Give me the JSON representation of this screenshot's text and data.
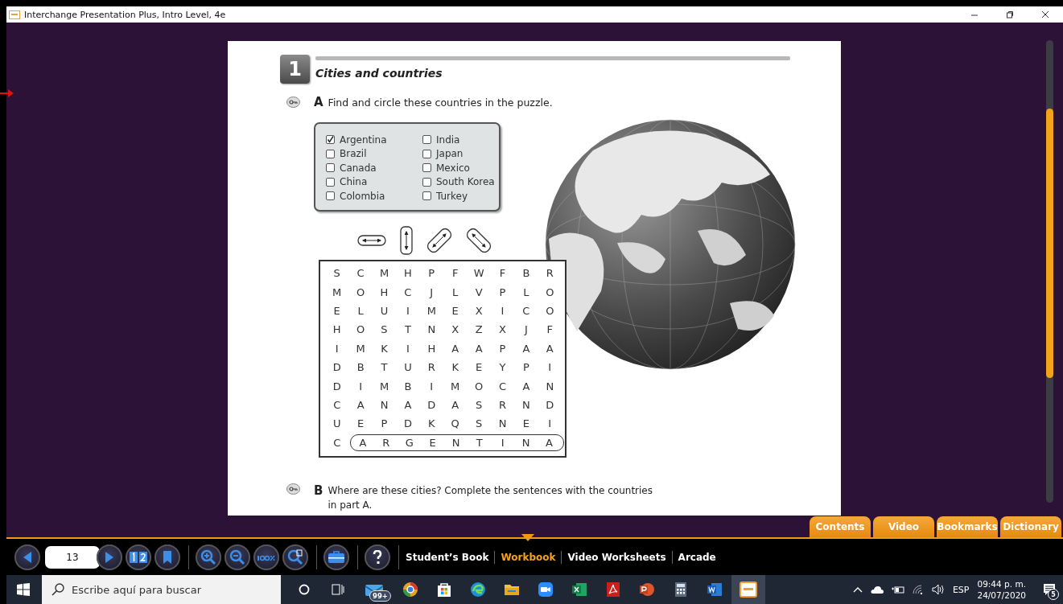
{
  "window": {
    "title": "Interchange Presentation Plus, Intro Level, 4e"
  },
  "page": {
    "exercise_number": "1",
    "section_title": "Cities and countries",
    "part_a": {
      "letter": "A",
      "instruction": "Find and circle these countries in the puzzle."
    },
    "checklist": [
      {
        "label": "Argentina",
        "checked": true
      },
      {
        "label": "Brazil",
        "checked": false
      },
      {
        "label": "Canada",
        "checked": false
      },
      {
        "label": "China",
        "checked": false
      },
      {
        "label": "Colombia",
        "checked": false
      },
      {
        "label": "India",
        "checked": false
      },
      {
        "label": "Japan",
        "checked": false
      },
      {
        "label": "Mexico",
        "checked": false
      },
      {
        "label": "South Korea",
        "checked": false
      },
      {
        "label": "Turkey",
        "checked": false
      }
    ],
    "word_search": {
      "rows": [
        {
          "segments": [
            {
              "letters": [
                "S",
                "C",
                "M",
                "H",
                "P",
                "F",
                "W",
                "F",
                "B",
                "R"
              ],
              "circled": false
            }
          ]
        },
        {
          "segments": [
            {
              "letters": [
                "M",
                "O",
                "H",
                "C",
                "J",
                "L",
                "V",
                "P",
                "L",
                "O"
              ],
              "circled": false
            }
          ]
        },
        {
          "segments": [
            {
              "letters": [
                "E",
                "L",
                "U",
                "I",
                "M",
                "E",
                "X",
                "I",
                "C",
                "O"
              ],
              "circled": false
            }
          ]
        },
        {
          "segments": [
            {
              "letters": [
                "H",
                "O",
                "S",
                "T",
                "N",
                "X",
                "Z",
                "X",
                "J",
                "F"
              ],
              "circled": false
            }
          ]
        },
        {
          "segments": [
            {
              "letters": [
                "I",
                "M",
                "K",
                "I",
                "H",
                "A",
                "A",
                "P",
                "A",
                "A"
              ],
              "circled": false
            }
          ]
        },
        {
          "segments": [
            {
              "letters": [
                "D",
                "B",
                "T",
                "U",
                "R",
                "K",
                "E",
                "Y",
                "P",
                "I"
              ],
              "circled": false
            }
          ]
        },
        {
          "segments": [
            {
              "letters": [
                "D",
                "I",
                "M",
                "B",
                "I",
                "M",
                "O",
                "C",
                "A",
                "N"
              ],
              "circled": false
            }
          ]
        },
        {
          "segments": [
            {
              "letters": [
                "C",
                "A",
                "N",
                "A",
                "D",
                "A",
                "S",
                "R",
                "N",
                "D"
              ],
              "circled": false
            }
          ]
        },
        {
          "segments": [
            {
              "letters": [
                "U",
                "E",
                "P",
                "D",
                "K",
                "Q",
                "S",
                "N",
                "E",
                "I"
              ],
              "circled": false
            }
          ]
        },
        {
          "segments": [
            {
              "letters": [
                "C"
              ],
              "circled": false
            },
            {
              "letters": [
                "A",
                "R",
                "G",
                "E",
                "N",
                "T",
                "I",
                "N",
                "A"
              ],
              "circled": true
            }
          ]
        }
      ]
    },
    "part_b": {
      "letter": "B",
      "instruction": "Where are these cities? Complete the sentences with the countries in part A."
    }
  },
  "side_tabs": [
    {
      "label": "Contents",
      "selected": false
    },
    {
      "label": "Video",
      "selected": false
    },
    {
      "label": "Bookmarks",
      "selected": false
    },
    {
      "label": "Dictionary",
      "selected": false
    }
  ],
  "toolbar": {
    "page_number": "13",
    "books": [
      {
        "label": "Student’s Book",
        "selected": false
      },
      {
        "label": "Workbook",
        "selected": true
      },
      {
        "label": "Video Worksheets",
        "selected": false
      },
      {
        "label": "Arcade",
        "selected": false
      }
    ]
  },
  "taskbar": {
    "search_placeholder": "Escribe aquí para buscar",
    "mail_badge": "99+",
    "language": "ESP",
    "time": "09:44 p. m.",
    "date": "24/07/2020",
    "notification_count": "5"
  }
}
